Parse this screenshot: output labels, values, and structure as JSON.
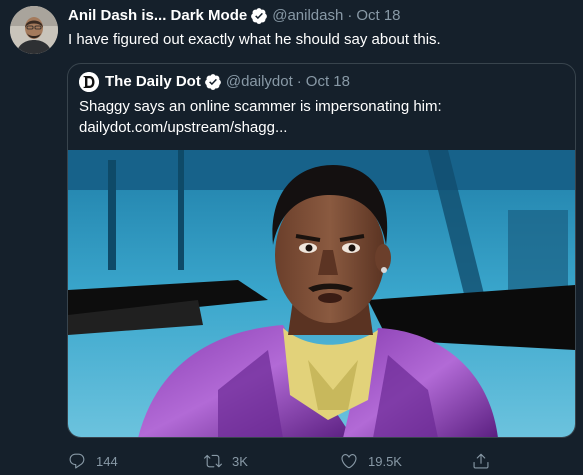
{
  "tweet": {
    "display_name": "Anil Dash is... Dark Mode",
    "handle": "@anildash",
    "separator": "·",
    "date": "Oct 18",
    "text": "I have figured out exactly what he should say about this."
  },
  "quote": {
    "display_name": "The Daily Dot",
    "handle": "@dailydot",
    "separator": "·",
    "date": "Oct 18",
    "text_line1": "Shaggy says an online scammer is impersonating him:",
    "text_line2": "dailydot.com/upstream/shagg...",
    "logo_letter": "D"
  },
  "actions": {
    "reply_count": "144",
    "retweet_count": "3K",
    "like_count": "19.5K"
  },
  "icons": {
    "verified": "verified-badge-icon",
    "reply": "reply-icon",
    "retweet": "retweet-icon",
    "like": "heart-icon",
    "share": "share-icon"
  },
  "colors": {
    "background": "#15202b",
    "secondary_text": "#8899a6",
    "border": "#38444d",
    "accent": "#1da1f2"
  }
}
